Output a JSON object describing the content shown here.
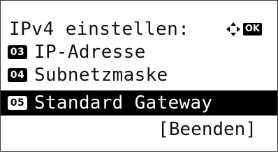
{
  "screen": {
    "title": "IPv4 einstellen:",
    "ok_label": "OK",
    "nav_icon": "four-way-arrows-icon"
  },
  "menu": {
    "items": [
      {
        "number": "03",
        "label": "IP-Adresse",
        "selected": false
      },
      {
        "number": "04",
        "label": "Subnetzmaske",
        "selected": false
      },
      {
        "number": "05",
        "label": "Standard Gateway",
        "selected": true
      }
    ]
  },
  "footer": {
    "exit_label": "[Beenden]"
  },
  "colors": {
    "background": "#ffffff",
    "text": "#111111",
    "highlight": "#000000",
    "highlight_text": "#ffffff"
  }
}
